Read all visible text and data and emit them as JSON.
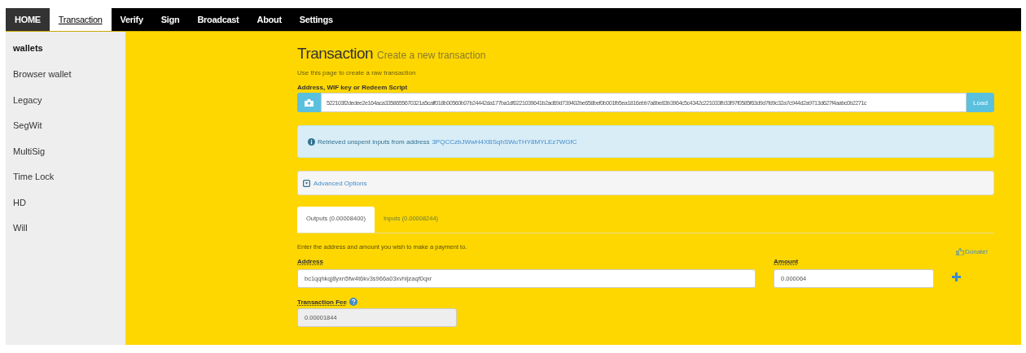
{
  "nav": [
    {
      "label": "HOME",
      "kind": "home",
      "selected": false
    },
    {
      "label": "Transaction",
      "kind": "link",
      "selected": true
    },
    {
      "label": "Verify",
      "kind": "link",
      "selected": false
    },
    {
      "label": "Sign",
      "kind": "link",
      "selected": false
    },
    {
      "label": "Broadcast",
      "kind": "link",
      "selected": false
    },
    {
      "label": "About",
      "kind": "link",
      "selected": false
    },
    {
      "label": "Settings",
      "kind": "link",
      "selected": false
    }
  ],
  "sidebar": {
    "heading": "wallets",
    "items": [
      "Browser wallet",
      "Legacy",
      "SegWit",
      "MultiSig",
      "Time Lock",
      "HD",
      "Will"
    ]
  },
  "page": {
    "title": "Transaction",
    "subtitle": "Create a new transaction",
    "description": "Use this page to create a raw transaction"
  },
  "script_field": {
    "label": "Address, WIF key or Redeem Script",
    "value": "522103f2dedee2e164aca3358655670321a5caff018b00560b07b24442da177ba1df0221039641b2ad69d739402be658bef0b001fb5ea1816ebb7a8be83b3964c5c4342c221033fb33f97f0585f63d9d7fd9c32a7c944d2a9713d627f4aabc0b2271c",
    "button": "Load"
  },
  "alert": {
    "text": "Retrieved unspent inputs from address",
    "link": "3PQCCzbJWwH4XBSqhSWuTHY8MYLEz7WGfC"
  },
  "advanced": {
    "label": "Advanced Options",
    "expanded": false
  },
  "tabs": [
    {
      "label": "Outputs (0.00008400)",
      "selected": true
    },
    {
      "label": "Inputs (0.00008244)",
      "selected": false
    }
  ],
  "outputs": {
    "instruction": "Enter the address and amount you wish to make a payment to.",
    "donate": "Donate!",
    "address_label": "Address",
    "address": "bc1qqhkqj8yxn5fw4t6kv3s966a03xvhljzaqf0qxr",
    "amount_label": "Amount",
    "amount": "0.000064"
  },
  "fee": {
    "label": "Transaction Fee",
    "value": "0.00001844"
  }
}
